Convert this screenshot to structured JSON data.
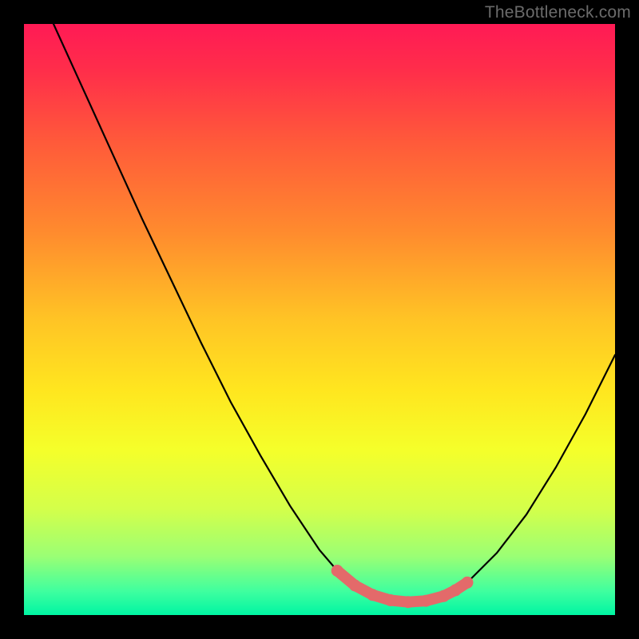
{
  "watermark": "TheBottleneck.com",
  "chart_data": {
    "type": "line",
    "title": "",
    "xlabel": "",
    "ylabel": "",
    "xlim": [
      0,
      100
    ],
    "ylim": [
      0,
      100
    ],
    "grid": false,
    "legend": false,
    "series": [
      {
        "name": "gradient-background",
        "type": "area",
        "stops": [
          {
            "offset": 0.0,
            "color": "#ff1a55"
          },
          {
            "offset": 0.08,
            "color": "#ff2e4a"
          },
          {
            "offset": 0.2,
            "color": "#ff5a3a"
          },
          {
            "offset": 0.35,
            "color": "#ff8a2e"
          },
          {
            "offset": 0.5,
            "color": "#ffc425"
          },
          {
            "offset": 0.62,
            "color": "#ffe61f"
          },
          {
            "offset": 0.72,
            "color": "#f5ff2a"
          },
          {
            "offset": 0.82,
            "color": "#d4ff4a"
          },
          {
            "offset": 0.9,
            "color": "#9bff74"
          },
          {
            "offset": 0.96,
            "color": "#3fff9f"
          },
          {
            "offset": 1.0,
            "color": "#00f5a3"
          }
        ]
      },
      {
        "name": "bottleneck-curve",
        "type": "line",
        "color": "#000000",
        "x": [
          5,
          10,
          15,
          20,
          25,
          30,
          35,
          40,
          45,
          50,
          53,
          56,
          59,
          62,
          65,
          68,
          71,
          75,
          80,
          85,
          90,
          95,
          100
        ],
        "values": [
          100,
          89,
          78,
          67,
          56.5,
          46,
          36,
          27,
          18.5,
          11,
          7.5,
          5,
          3.4,
          2.5,
          2.2,
          2.4,
          3.2,
          5.5,
          10.5,
          17,
          25,
          34,
          44
        ]
      },
      {
        "name": "highlight-segment",
        "type": "line",
        "color": "#e36a6a",
        "thick": true,
        "x": [
          53,
          56,
          59,
          62,
          65,
          68,
          71,
          73,
          75
        ],
        "values": [
          7.5,
          5,
          3.4,
          2.5,
          2.2,
          2.4,
          3.2,
          4.2,
          5.5
        ]
      }
    ]
  }
}
